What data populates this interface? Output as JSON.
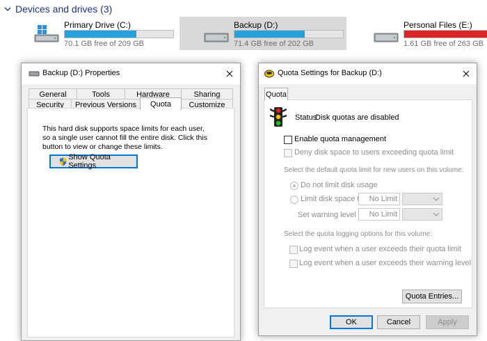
{
  "explorer": {
    "section_title": "Devices and drives (3)",
    "drives": [
      {
        "name": "Primary Drive (C:)",
        "free_text": "70.1 GB free of 209 GB",
        "used_fraction": 0.66,
        "bar_color": "#26a0da",
        "icon": "hard-drive-windows-icon"
      },
      {
        "name": "Backup (D:)",
        "free_text": "71.4 GB free of 202 GB",
        "used_fraction": 0.65,
        "bar_color": "#26a0da",
        "icon": "hard-drive-icon"
      },
      {
        "name": "Personal Files (E:)",
        "free_text": "1.61 GB free of 263 GB",
        "used_fraction": 0.99,
        "bar_color": "#da2626",
        "icon": "hard-drive-icon"
      }
    ]
  },
  "properties": {
    "title": "Backup (D:) Properties",
    "tabs_row1": [
      "General",
      "Tools",
      "Hardware",
      "Sharing"
    ],
    "tabs_row2": [
      "Security",
      "Previous Versions",
      "Quota",
      "Customize"
    ],
    "active_tab": "Quota",
    "description": "This hard disk supports space limits for each user, so a single user cannot fill the entire disk. Click this button to view or change these limits.",
    "show_quota_button": "Show Quota Settings"
  },
  "quota": {
    "title": "Quota Settings for Backup (D:)",
    "tab": "Quota",
    "status_label": "Status:",
    "status_value": "Disk quotas are disabled",
    "enable_label": "Enable quota management",
    "enable_checked": false,
    "deny_label": "Deny disk space to users exceeding quota limit",
    "default_limit_heading": "Select the default quota limit for new users on this volume:",
    "no_limit_label": "Do not limit disk usage",
    "limit_label": "Limit disk space to",
    "limit_value": "No Limit",
    "warning_label": "Set warning level to",
    "warning_value": "No Limit",
    "logging_heading": "Select the quota logging options for this volume:",
    "log_limit_label": "Log event when a user exceeds their quota limit",
    "log_warning_label": "Log event when a user exceeds their warning level",
    "entries_button": "Quota Entries...",
    "ok_button": "OK",
    "cancel_button": "Cancel",
    "apply_button": "Apply"
  }
}
